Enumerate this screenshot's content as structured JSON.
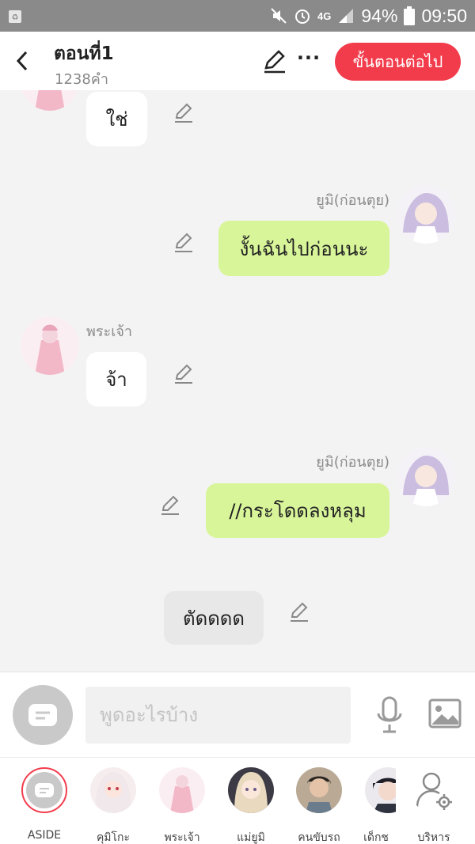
{
  "status_bar": {
    "battery": "94%",
    "time": "09:50",
    "network": "4G",
    "icons": [
      "recycle-icon",
      "mute-icon",
      "alarm-icon",
      "signal-icon",
      "battery-icon"
    ]
  },
  "header": {
    "title": "ตอนที่1",
    "word_count": "1238คำ",
    "next_button": "ขั้นตอนต่อไป",
    "more_label": "···"
  },
  "messages": [
    {
      "speaker": "",
      "text": "ใช่",
      "side": "left"
    },
    {
      "speaker": "ยูมิ(ก่อนตุย)",
      "text": "งั้นฉันไปก่อนนะ",
      "side": "right"
    },
    {
      "speaker": "พระเจ้า",
      "text": "จ้า",
      "side": "left"
    },
    {
      "speaker": "ยูมิ(ก่อนตุย)",
      "text": "//กระโดดลงหลุม",
      "side": "right"
    },
    {
      "speaker": "",
      "text": "ตัดดดด",
      "side": "center"
    }
  ],
  "input": {
    "placeholder": "พูดอะไรบ้าง"
  },
  "characters": [
    {
      "label": "ASIDE"
    },
    {
      "label": "คุมิโกะ"
    },
    {
      "label": "พระเจ้า"
    },
    {
      "label": "แม่ยูมิ"
    },
    {
      "label": "คนขับรถ"
    },
    {
      "label": "เด็กช"
    },
    {
      "label": "บริหาร"
    }
  ],
  "colors": {
    "accent_red": "#f23c4c",
    "bubble_green": "#d8f59a",
    "background": "#f3f3f3"
  }
}
